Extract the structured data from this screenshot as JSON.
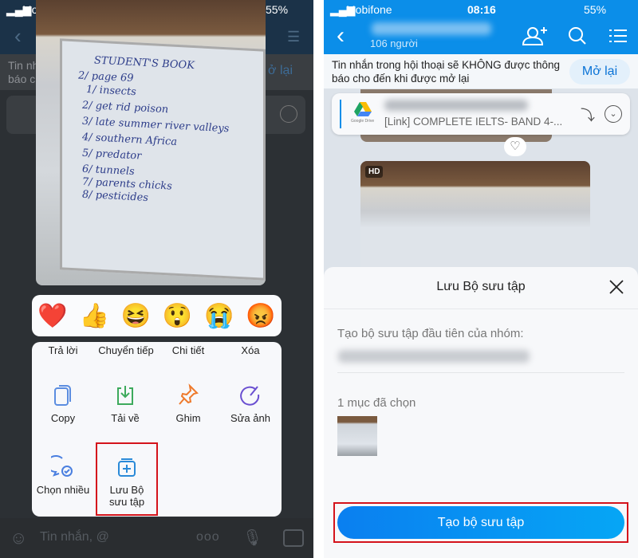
{
  "status": {
    "carrier": "Mobifone",
    "time": "08:16",
    "battery": "55%"
  },
  "left": {
    "banner": {
      "line1": "Tin nh",
      "line2": "báo c",
      "reopen": "ở lại"
    },
    "whiteboard": [
      "STUDENT'S BOOK",
      "2/ page 69",
      "1/ insects",
      "2/ get rid  poison",
      "3/ late summer  river valleys",
      "4/ southern Africa",
      "5/ predator",
      "6/ tunnels",
      "7/ parents  chicks",
      "8/ pesticides"
    ],
    "reactions": [
      {
        "icon": "heart-icon",
        "glyph": "❤️"
      },
      {
        "icon": "thumbs-up-icon",
        "glyph": "👍"
      },
      {
        "icon": "laugh-icon",
        "glyph": "😆"
      },
      {
        "icon": "surprised-icon",
        "glyph": "😲"
      },
      {
        "icon": "crying-icon",
        "glyph": "😭"
      },
      {
        "icon": "angry-icon",
        "glyph": "😡"
      }
    ],
    "menu": {
      "top": [
        "Trả lời",
        "Chuyển tiếp",
        "Chi tiết",
        "Xóa"
      ],
      "copy": "Copy",
      "download": "Tải về",
      "pin": "Ghim",
      "edit": "Sửa ảnh",
      "multi": "Chọn nhiều",
      "save_line1": "Lưu Bộ",
      "save_line2": "sưu tập"
    },
    "input_placeholder": "Tin nhắn, @"
  },
  "right": {
    "members": "106 người",
    "banner": {
      "text_line1": "Tin nhắn trong hội thoại sẽ KHÔNG được thông",
      "text_line2": "báo cho đến khi được mở lại",
      "reopen": "Mở lại"
    },
    "pinned": {
      "drive_label": "Google Drive",
      "link": "[Link] COMPLETE IELTS- BAND 4-..."
    },
    "hd_badge": "HD",
    "sheet": {
      "title": "Lưu Bộ sưu tập",
      "label": "Tạo bộ sưu tập đầu tiên của nhóm:",
      "selected": "1 mục đã chọn",
      "create_button": "Tạo bộ sưu tập"
    }
  },
  "colors": {
    "accent": "#0b8ee9",
    "highlight": "#d4131b"
  }
}
